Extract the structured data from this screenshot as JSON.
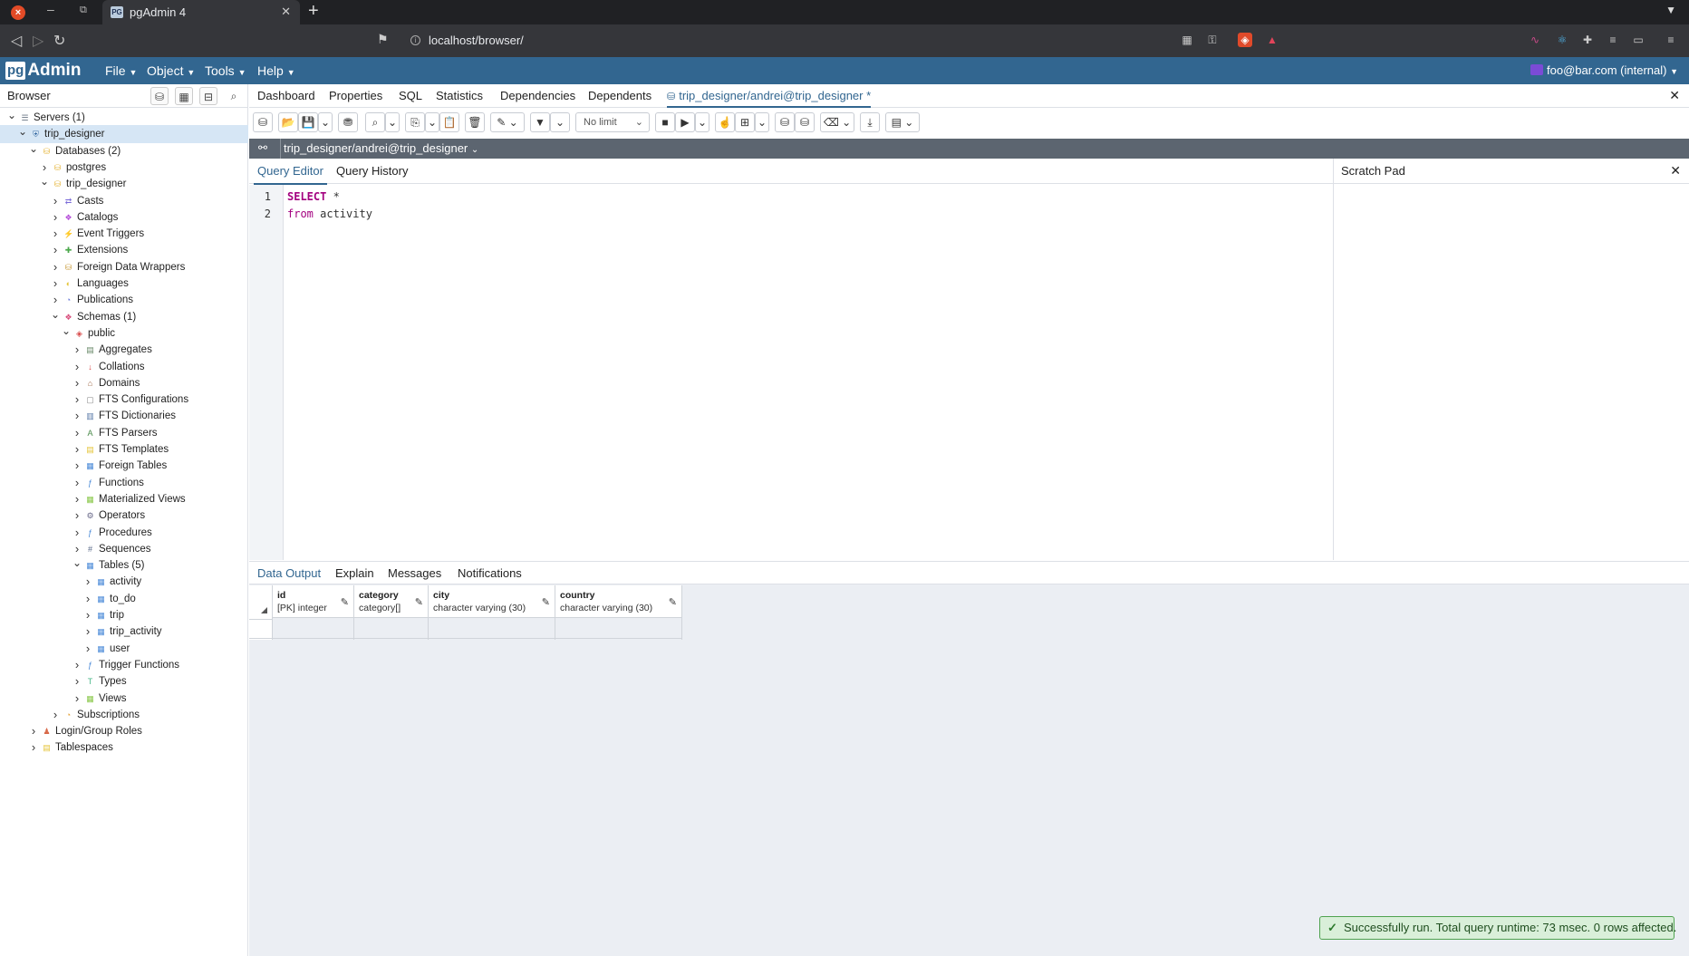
{
  "browser": {
    "tab_title": "pgAdmin 4",
    "tab_favicon": "PG",
    "url": "localhost/browser/"
  },
  "menubar": {
    "logo_pg": "pg",
    "logo_admin": "Admin",
    "items": [
      "File",
      "Object",
      "Tools",
      "Help"
    ],
    "user": "foo@bar.com (internal)"
  },
  "left_panel": {
    "title": "Browser",
    "tree": [
      {
        "label": "Servers (1)",
        "depth": 0,
        "expanded": true,
        "icon": "server-group-icon"
      },
      {
        "label": "trip_designer",
        "depth": 1,
        "expanded": true,
        "icon": "server-icon",
        "selected": true
      },
      {
        "label": "Databases (2)",
        "depth": 2,
        "expanded": true,
        "icon": "databases-icon"
      },
      {
        "label": "postgres",
        "depth": 3,
        "expanded": false,
        "icon": "database-icon"
      },
      {
        "label": "trip_designer",
        "depth": 3,
        "expanded": true,
        "icon": "database-icon"
      },
      {
        "label": "Casts",
        "depth": 4,
        "expanded": false,
        "icon": "casts-icon"
      },
      {
        "label": "Catalogs",
        "depth": 4,
        "expanded": false,
        "icon": "catalogs-icon"
      },
      {
        "label": "Event Triggers",
        "depth": 4,
        "expanded": false,
        "icon": "event-triggers-icon"
      },
      {
        "label": "Extensions",
        "depth": 4,
        "expanded": false,
        "icon": "extensions-icon"
      },
      {
        "label": "Foreign Data Wrappers",
        "depth": 4,
        "expanded": false,
        "icon": "fdw-icon"
      },
      {
        "label": "Languages",
        "depth": 4,
        "expanded": false,
        "icon": "languages-icon"
      },
      {
        "label": "Publications",
        "depth": 4,
        "expanded": false,
        "icon": "publications-icon"
      },
      {
        "label": "Schemas (1)",
        "depth": 4,
        "expanded": true,
        "icon": "schemas-icon"
      },
      {
        "label": "public",
        "depth": 5,
        "expanded": true,
        "icon": "schema-icon"
      },
      {
        "label": "Aggregates",
        "depth": 6,
        "expanded": false,
        "icon": "aggregates-icon"
      },
      {
        "label": "Collations",
        "depth": 6,
        "expanded": false,
        "icon": "collations-icon"
      },
      {
        "label": "Domains",
        "depth": 6,
        "expanded": false,
        "icon": "domains-icon"
      },
      {
        "label": "FTS Configurations",
        "depth": 6,
        "expanded": false,
        "icon": "fts-config-icon"
      },
      {
        "label": "FTS Dictionaries",
        "depth": 6,
        "expanded": false,
        "icon": "fts-dict-icon"
      },
      {
        "label": "FTS Parsers",
        "depth": 6,
        "expanded": false,
        "icon": "fts-parsers-icon"
      },
      {
        "label": "FTS Templates",
        "depth": 6,
        "expanded": false,
        "icon": "fts-templates-icon"
      },
      {
        "label": "Foreign Tables",
        "depth": 6,
        "expanded": false,
        "icon": "foreign-tables-icon"
      },
      {
        "label": "Functions",
        "depth": 6,
        "expanded": false,
        "icon": "functions-icon"
      },
      {
        "label": "Materialized Views",
        "depth": 6,
        "expanded": false,
        "icon": "mviews-icon"
      },
      {
        "label": "Operators",
        "depth": 6,
        "expanded": false,
        "icon": "operators-icon"
      },
      {
        "label": "Procedures",
        "depth": 6,
        "expanded": false,
        "icon": "procedures-icon"
      },
      {
        "label": "Sequences",
        "depth": 6,
        "expanded": false,
        "icon": "sequences-icon"
      },
      {
        "label": "Tables (5)",
        "depth": 6,
        "expanded": true,
        "icon": "tables-icon"
      },
      {
        "label": "activity",
        "depth": 7,
        "expanded": false,
        "icon": "table-icon"
      },
      {
        "label": "to_do",
        "depth": 7,
        "expanded": false,
        "icon": "table-icon"
      },
      {
        "label": "trip",
        "depth": 7,
        "expanded": false,
        "icon": "table-icon"
      },
      {
        "label": "trip_activity",
        "depth": 7,
        "expanded": false,
        "icon": "table-icon"
      },
      {
        "label": "user",
        "depth": 7,
        "expanded": false,
        "icon": "table-icon"
      },
      {
        "label": "Trigger Functions",
        "depth": 6,
        "expanded": false,
        "icon": "trigger-functions-icon"
      },
      {
        "label": "Types",
        "depth": 6,
        "expanded": false,
        "icon": "types-icon"
      },
      {
        "label": "Views",
        "depth": 6,
        "expanded": false,
        "icon": "views-icon"
      },
      {
        "label": "Subscriptions",
        "depth": 4,
        "expanded": false,
        "icon": "subscriptions-icon"
      },
      {
        "label": "Login/Group Roles",
        "depth": 2,
        "expanded": false,
        "icon": "roles-icon"
      },
      {
        "label": "Tablespaces",
        "depth": 2,
        "expanded": false,
        "icon": "tablespaces-icon"
      }
    ]
  },
  "main_tabs": {
    "items": [
      "Dashboard",
      "Properties",
      "SQL",
      "Statistics",
      "Dependencies",
      "Dependents"
    ],
    "active": "trip_designer/andrei@trip_designer *"
  },
  "toolbar": {
    "limit_select": "No limit"
  },
  "connection": {
    "label": "trip_designer/andrei@trip_designer"
  },
  "editor": {
    "tabs": [
      "Query Editor",
      "Query History"
    ],
    "lines": [
      {
        "num": "1",
        "kw": "SELECT",
        "rest": " *"
      },
      {
        "num": "2",
        "kw": "from",
        "rest": " activity"
      }
    ]
  },
  "scratch_pad": {
    "title": "Scratch Pad"
  },
  "output": {
    "tabs": [
      "Data Output",
      "Explain",
      "Messages",
      "Notifications"
    ],
    "columns": [
      {
        "name": "id",
        "type": "[PK] integer"
      },
      {
        "name": "category",
        "type": "category[]"
      },
      {
        "name": "city",
        "type": "character varying (30)"
      },
      {
        "name": "country",
        "type": "character varying (30)"
      }
    ]
  },
  "toast": {
    "message": "Successfully run. Total query runtime: 73 msec. 0 rows affected."
  },
  "colors": {
    "brand": "#326690",
    "success_bg": "#d9efd9",
    "keyword": "#a3007f"
  }
}
